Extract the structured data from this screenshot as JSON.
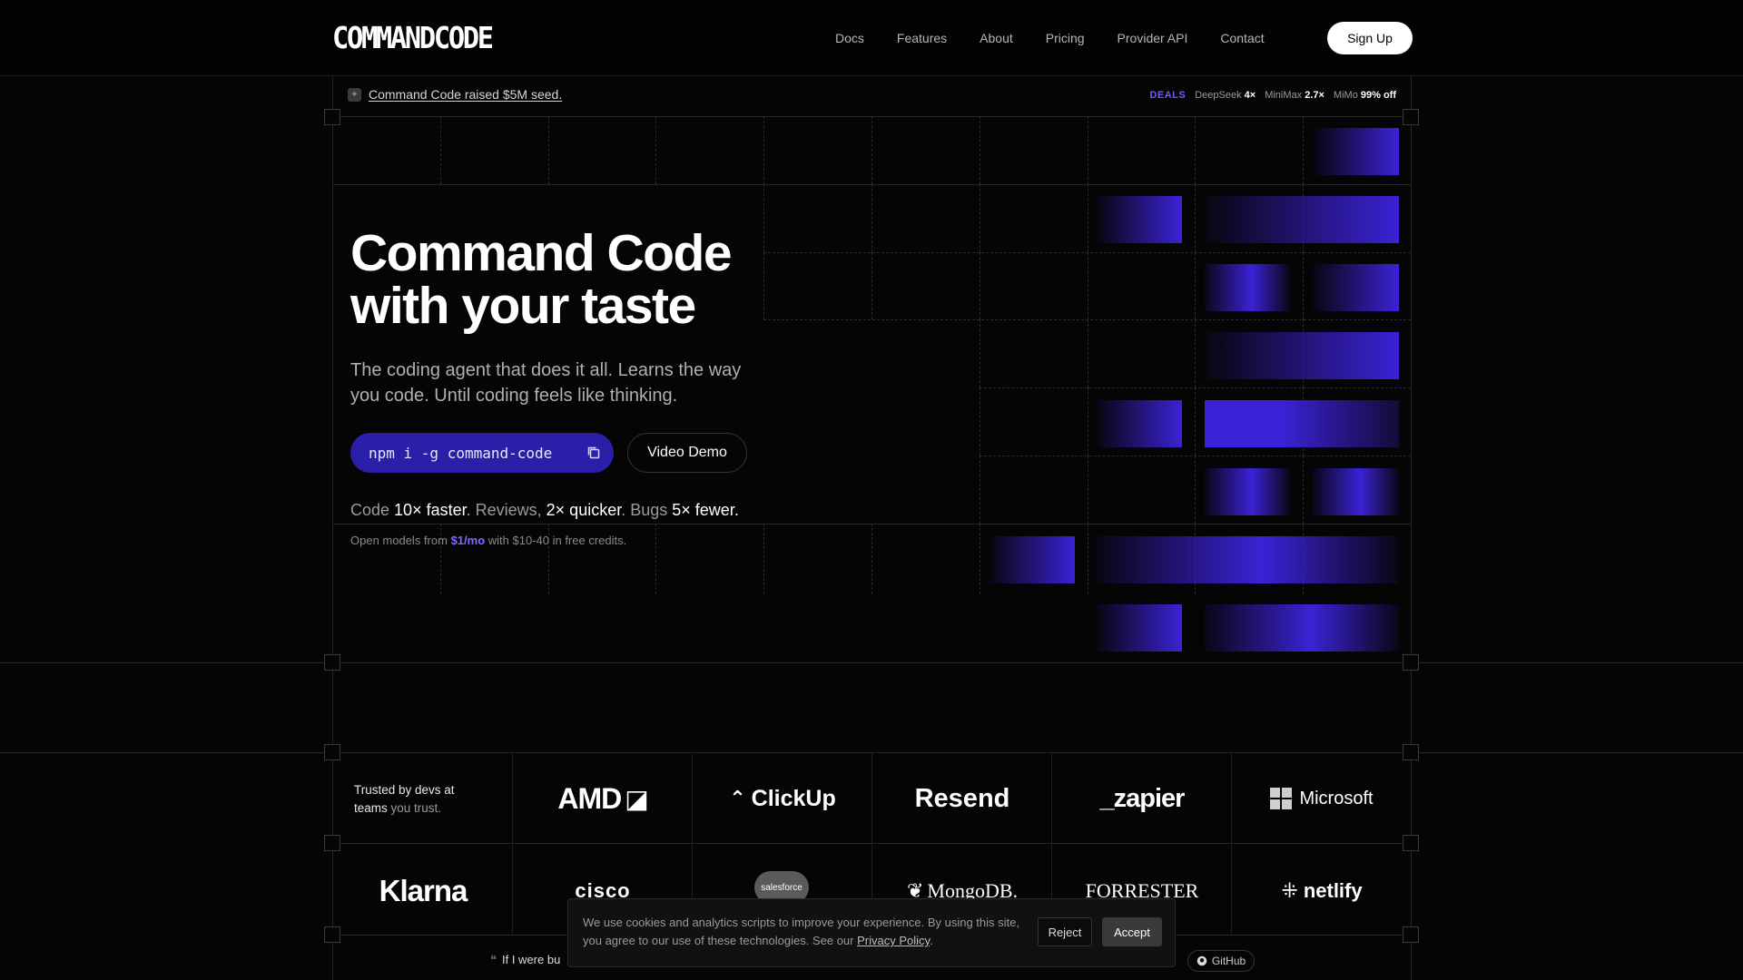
{
  "header": {
    "logo": "COMMANDCODE",
    "nav": [
      "Docs",
      "Features",
      "About",
      "Pricing",
      "Provider API",
      "Contact"
    ],
    "signup": "Sign Up"
  },
  "announcement": {
    "text": "Command Code raised $5M seed."
  },
  "deals": {
    "label": "DEALS",
    "items": [
      {
        "name": "DeepSeek",
        "value": "4×"
      },
      {
        "name": "MiniMax",
        "value": "2.7×"
      },
      {
        "name": "MiMo",
        "value": "99% off"
      }
    ]
  },
  "hero": {
    "title_line1": "Command Code",
    "title_line2": "with your taste",
    "subtitle": "The coding agent that does it all. Learns the way you code. Until coding feels like thinking.",
    "install_cmd": "npm i -g command-code",
    "demo_button": "Video Demo",
    "stats": {
      "a": "Code",
      "b": "10× faster",
      "c": ". Reviews,",
      "d": "2× quicker",
      "e": ". Bugs",
      "f": "5× fewer",
      "g": "."
    },
    "open_models": {
      "pre": "Open models from",
      "price": "$1/mo",
      "post": "with $10-40 in free credits."
    }
  },
  "logos": {
    "trust_line1": "Trusted by devs at",
    "trust_line2a": "teams",
    "trust_line2b": "you trust.",
    "row1": [
      "AMD",
      "ClickUp",
      "Resend",
      "_zapier",
      "Microsoft"
    ],
    "row2": [
      "Klarna",
      "cisco",
      "salesforce",
      "MongoDB.",
      "FORRESTER",
      "netlify"
    ]
  },
  "cookie": {
    "text": "We use cookies and analytics scripts to improve your experience. By using this site, you agree to our use of these technologies. See our",
    "link": "Privacy Policy",
    "reject": "Reject",
    "accept": "Accept"
  },
  "footer_strip": {
    "quote": "If I were bu",
    "github": "GitHub"
  },
  "colors": {
    "accent": "#2a1fa8",
    "tile": "#3b22d6",
    "background": "#050505"
  }
}
